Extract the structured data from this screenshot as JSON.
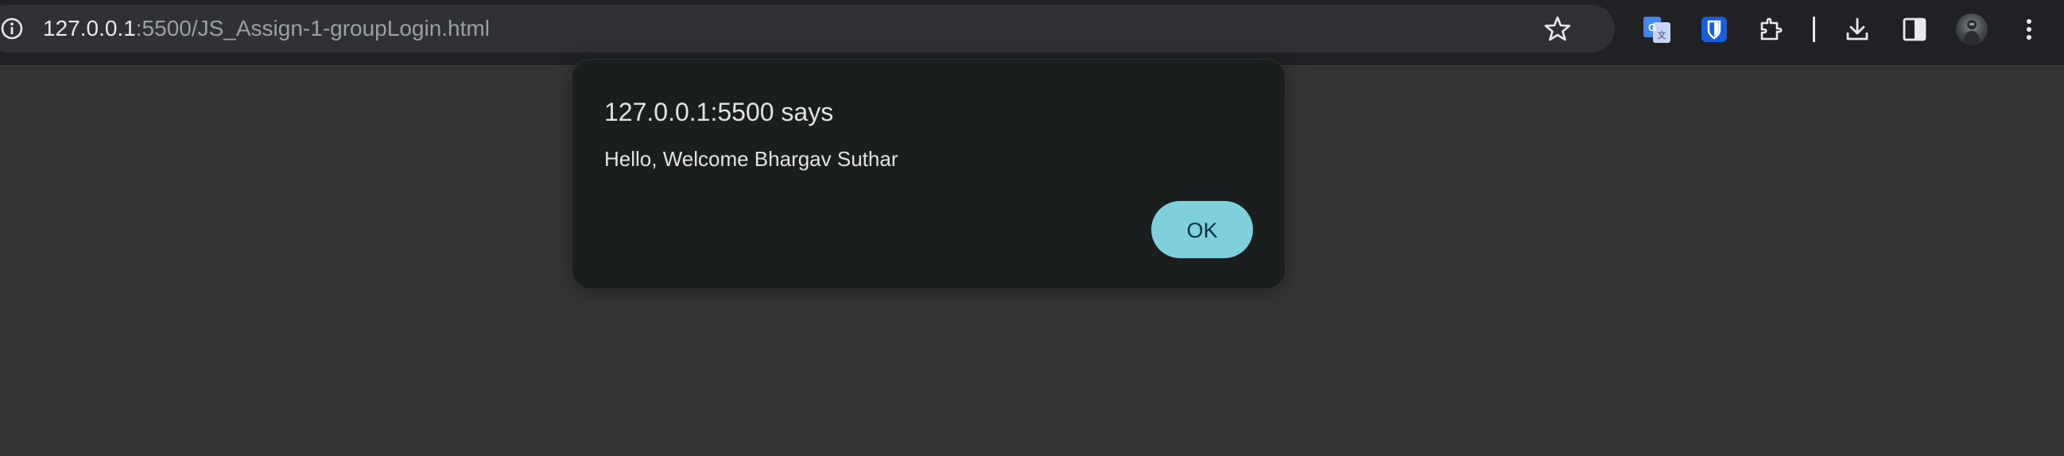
{
  "browser": {
    "url_host": "127.0.0.1",
    "url_path": ":5500/JS_Assign-1-groupLogin.html",
    "icons": {
      "site_info": "info-icon",
      "bookmark": "star-icon",
      "translate": "google-translate-icon",
      "bitwarden": "bitwarden-icon",
      "extensions": "puzzle-icon",
      "download": "download-icon",
      "side_panel": "side-panel-icon",
      "profile": "avatar",
      "menu": "kebab-menu-icon"
    }
  },
  "dialog": {
    "title": "127.0.0.1:5500 says",
    "message": "Hello, Welcome Bhargav Suthar",
    "ok_label": "OK"
  },
  "colors": {
    "page_bg": "#353535",
    "toolbar_bg": "#202124",
    "omnibox_bg": "#303134",
    "dialog_bg": "#1b1e1f",
    "ok_button": "#7fcfdd",
    "bitwarden_blue": "#175ddc",
    "translate_blue": "#4285f4"
  }
}
